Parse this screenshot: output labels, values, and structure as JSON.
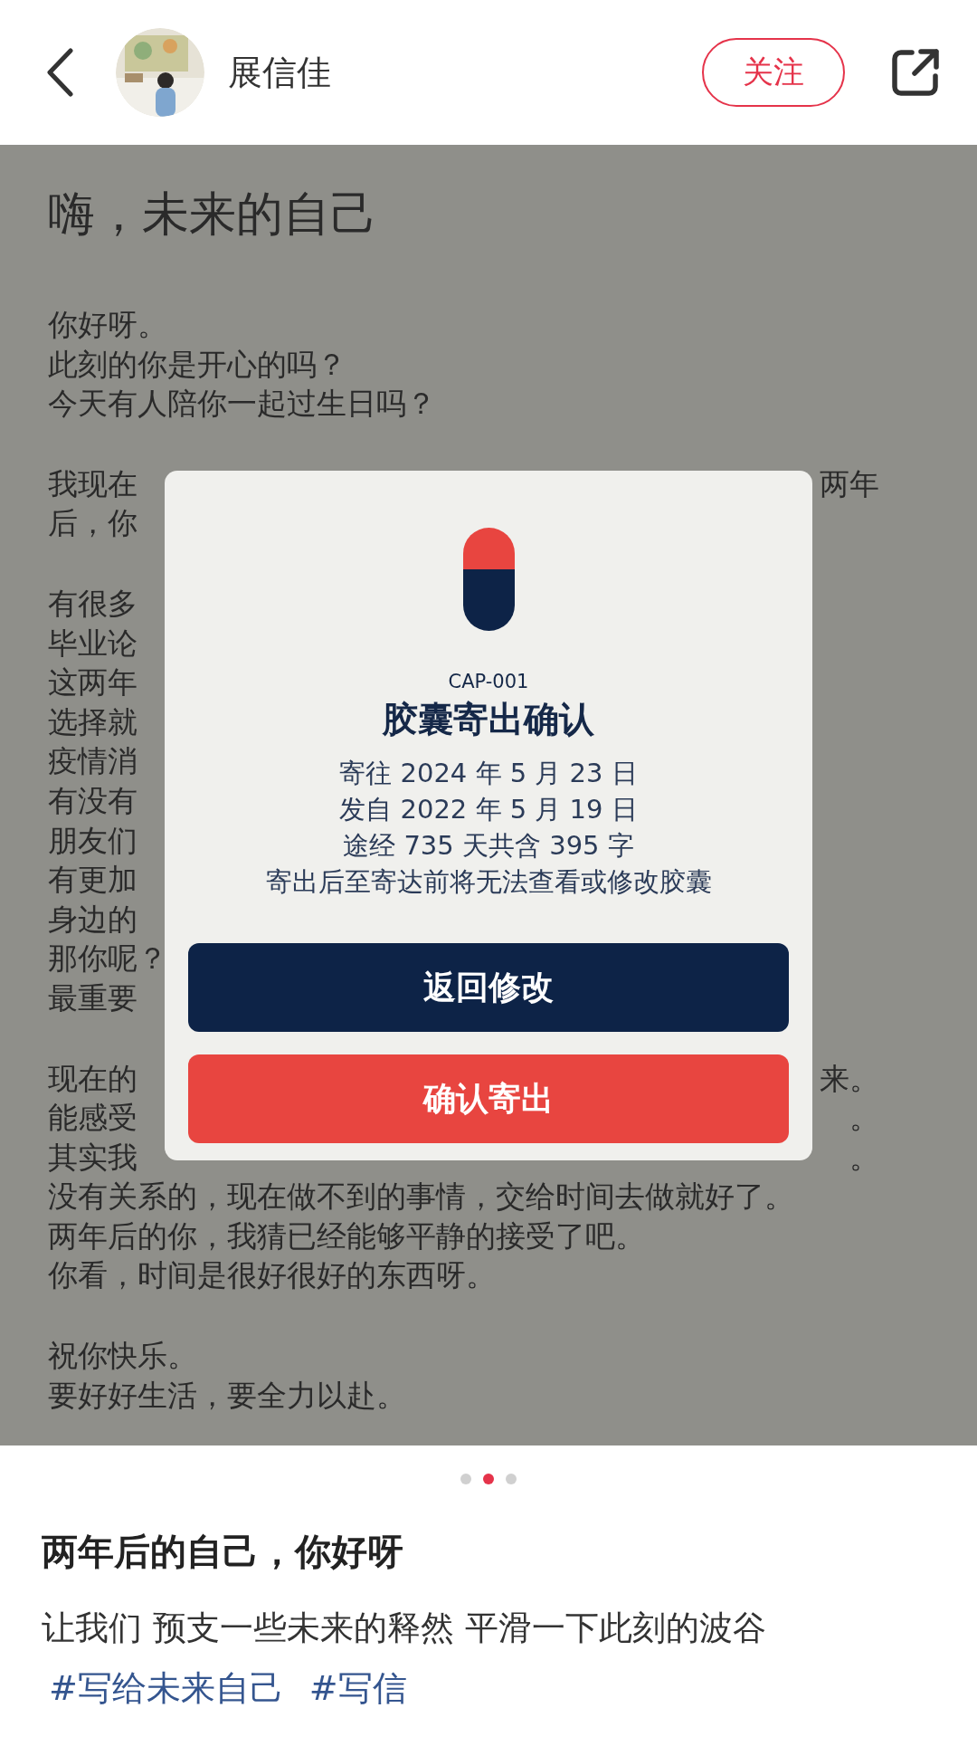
{
  "header": {
    "author": "展信佳",
    "follow_button": "关注"
  },
  "post_image": {
    "letter": {
      "title": "嗨，未来的自己",
      "paragraphs": [
        [
          {
            "text": "你好呀。"
          },
          {
            "text": "此刻的你是开心的吗？"
          },
          {
            "text": "今天有人陪你一起过生日吗？"
          }
        ],
        [
          {
            "text": "我现在",
            "right": "两年"
          },
          {
            "text": "后，你"
          }
        ],
        [
          {
            "text": "有很多"
          },
          {
            "text": "毕业论"
          },
          {
            "text": "这两年"
          },
          {
            "text": "选择就"
          },
          {
            "text": "疫情消"
          },
          {
            "text": "有没有"
          },
          {
            "text": "朋友们"
          },
          {
            "text": "有更加"
          },
          {
            "text": "身边的"
          },
          {
            "text": "那你呢？"
          },
          {
            "text": "最重要"
          }
        ],
        [
          {
            "text": "现在的",
            "right": "来。"
          },
          {
            "text": "能感受",
            "right": "。"
          },
          {
            "text": "其实我",
            "right": "。"
          },
          {
            "text": "没有关系的，现在做不到的事情，交给时间去做就好了。"
          },
          {
            "text": "两年后的你，我猜已经能够平静的接受了吧。"
          },
          {
            "text": "你看，时间是很好很好的东西呀。"
          }
        ],
        [
          {
            "text": "祝你快乐。"
          },
          {
            "text": "要好好生活，要全力以赴。"
          }
        ]
      ]
    },
    "dialog": {
      "code": "CAP-001",
      "title": "胶囊寄出确认",
      "details": [
        "寄往 2024 年 5 月 23 日",
        "发自 2022 年 5 月 19 日",
        "途经 735 天共含 395 字",
        "寄出后至寄达前将无法查看或修改胶囊"
      ],
      "buttons": [
        {
          "label": "返回修改",
          "kind": "secondary"
        },
        {
          "label": "确认寄出",
          "kind": "primary"
        }
      ]
    }
  },
  "carousel": {
    "dots": [
      {
        "selected": false
      },
      {
        "selected": true
      },
      {
        "selected": false
      }
    ]
  },
  "post": {
    "title": "两年后的自己，你好呀",
    "description": "让我们 预支一些未来的释然 平滑一下此刻的波谷",
    "tags": [
      "#写给未来自己",
      "#写信"
    ]
  }
}
